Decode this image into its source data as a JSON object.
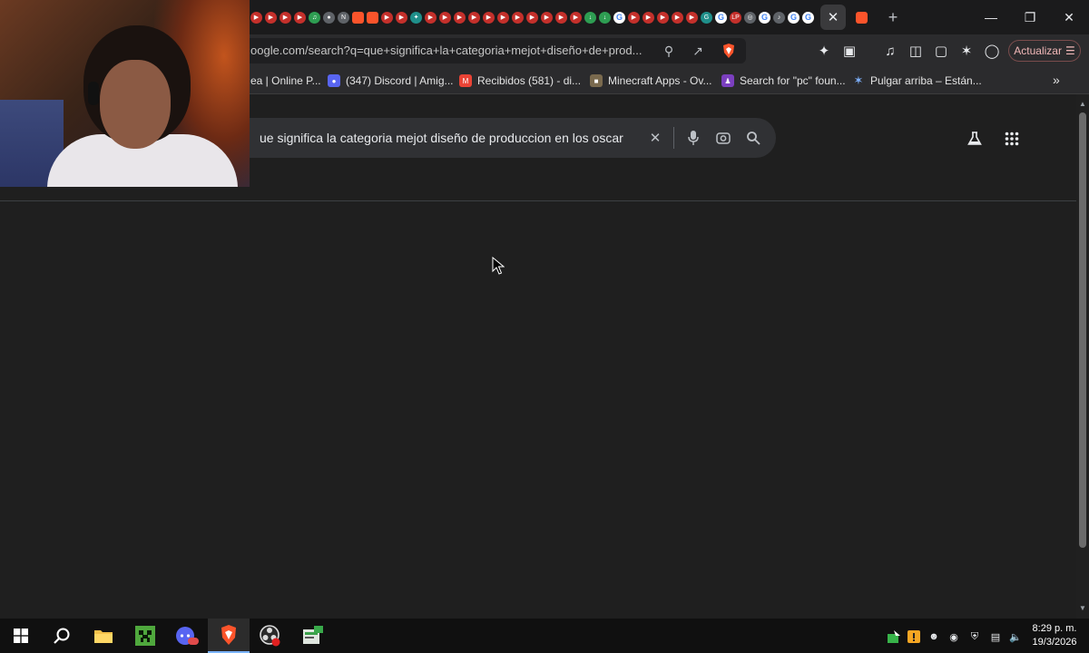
{
  "browser": {
    "url": "oogle.com/search?q=que+significa+la+categoria+mejot+diseño+de+prod...",
    "update_label": "Actualizar",
    "tab_icons": [
      "youtube",
      "youtube",
      "youtube",
      "youtube",
      "spotify",
      "github",
      "notion",
      "brave",
      "brave",
      "youtube",
      "youtube",
      "chatgpt",
      "youtube",
      "youtube",
      "youtube",
      "youtube",
      "youtube",
      "youtube",
      "youtube",
      "youtube",
      "youtube",
      "youtube",
      "youtube",
      "download",
      "download",
      "google",
      "youtube",
      "youtube",
      "youtube",
      "youtube",
      "youtube",
      "grammarly",
      "google",
      "lp",
      "world",
      "google",
      "tiktok",
      "google",
      "google"
    ]
  },
  "bookmarks": [
    {
      "label": "ea | Online P...",
      "icon": "page-icon"
    },
    {
      "label": "(347) Discord | Amig...",
      "icon": "discord-icon"
    },
    {
      "label": "Recibidos (581) - di...",
      "icon": "gmail-icon"
    },
    {
      "label": "Minecraft Apps - Ov...",
      "icon": "minecraft-icon"
    },
    {
      "label": "Search for \"pc\" foun...",
      "icon": "person-icon"
    },
    {
      "label": "Pulgar arriba – Están...",
      "icon": "star-icon"
    }
  ],
  "search": {
    "query": "ue significa la categoria mejot diseño de produccion en los oscar"
  },
  "taskbar": {
    "apps": [
      "windows",
      "search",
      "file-explorer",
      "minecraft",
      "discord",
      "brave",
      "obs",
      "minecraft-launcher"
    ],
    "clock_time": "8:29 p. m.",
    "clock_date": "19/3/2026"
  },
  "colors": {
    "page_bg": "#1f1f1f",
    "search_box": "#303134",
    "brave_orange": "#fb542b",
    "youtube_red": "#c4302b"
  }
}
